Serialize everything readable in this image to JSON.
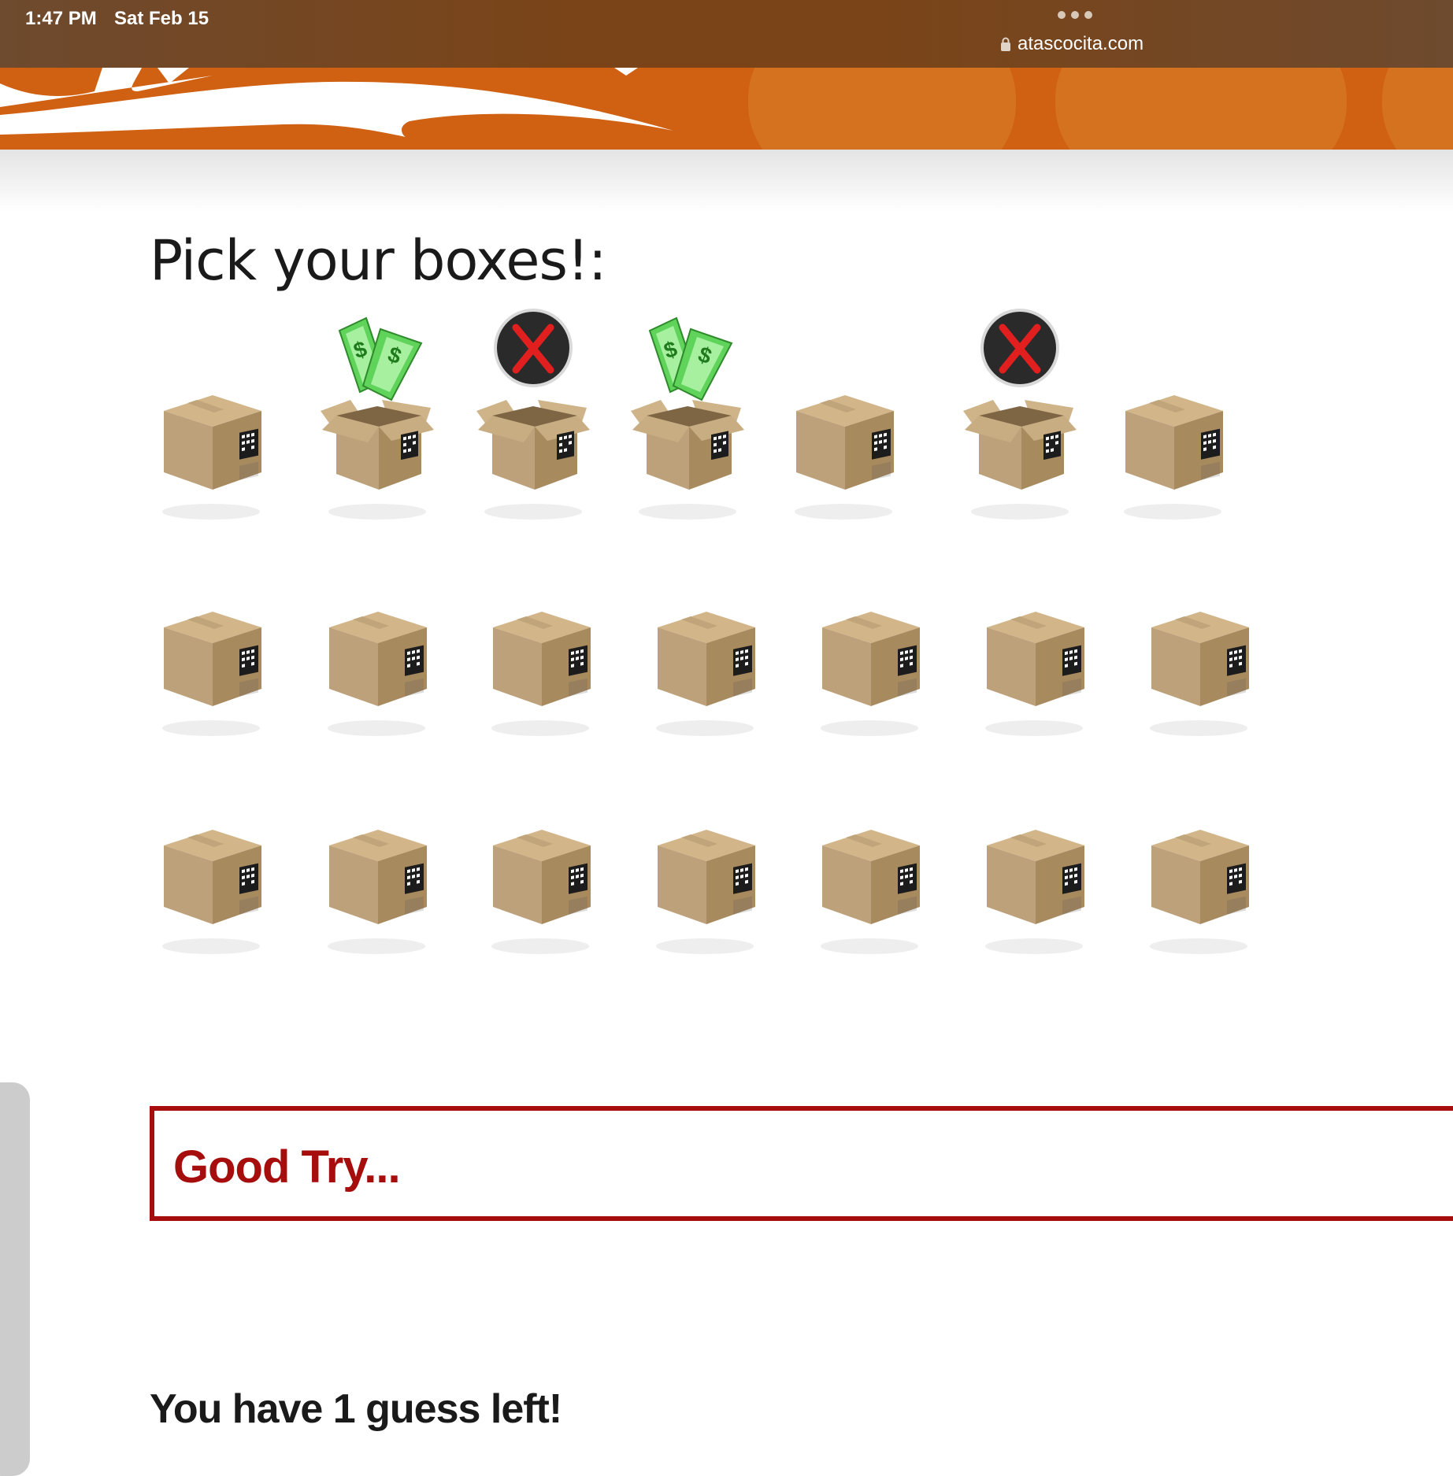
{
  "status_bar": {
    "time": "1:47 PM",
    "date": "Sat Feb 15",
    "url": "atascocita.com"
  },
  "page": {
    "heading": "Pick your boxes!:",
    "message": "Good Try...",
    "guesses_left": "You have 1 guess left!"
  },
  "colors": {
    "header_orange": "#d06012",
    "message_red": "#a60e0e",
    "box_tan": "#b89a6a"
  },
  "boxes": {
    "rows": [
      [
        "closed",
        "money",
        "x",
        "money",
        "closed",
        "x",
        "closed"
      ],
      [
        "closed",
        "closed",
        "closed",
        "closed",
        "closed",
        "closed",
        "closed"
      ],
      [
        "closed",
        "closed",
        "closed",
        "closed",
        "closed",
        "closed",
        "closed"
      ]
    ]
  }
}
